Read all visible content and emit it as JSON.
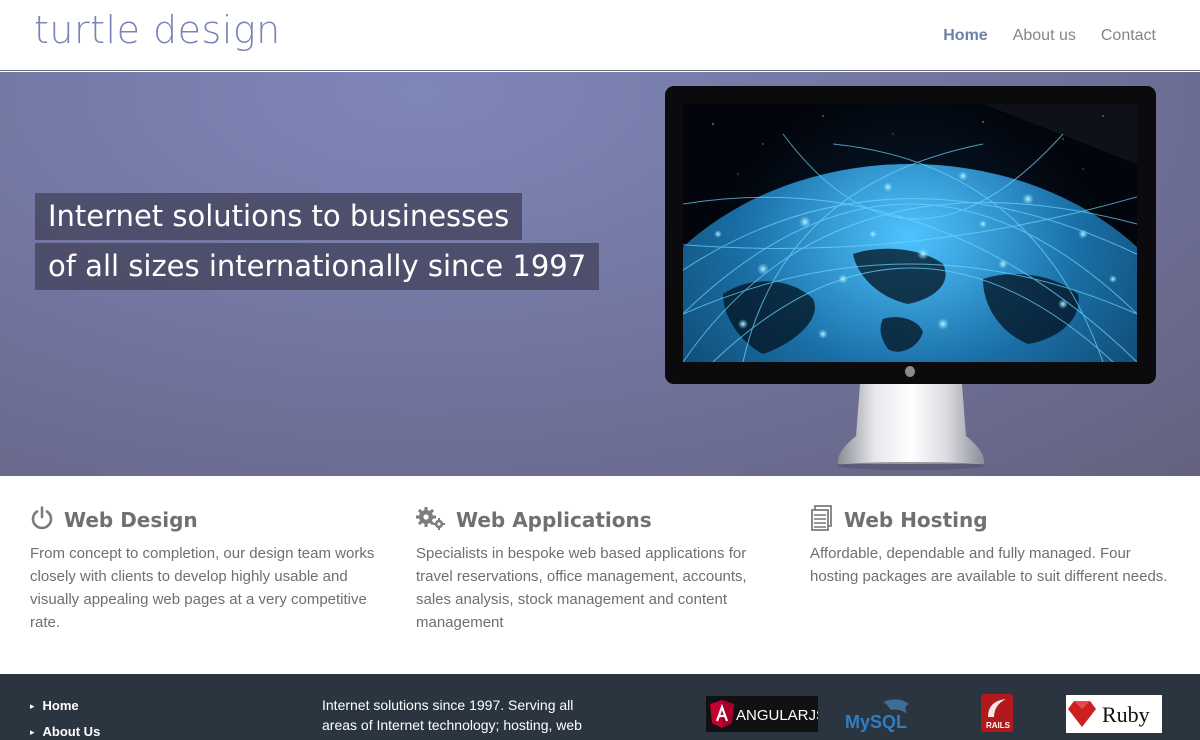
{
  "header": {
    "logo": "turtle design",
    "nav": [
      {
        "label": "Home",
        "active": true
      },
      {
        "label": "About us",
        "active": false
      },
      {
        "label": "Contact",
        "active": false
      }
    ]
  },
  "hero": {
    "headline_line1": "Internet solutions to businesses",
    "headline_line2": "of all sizes internationally since 1997"
  },
  "services": [
    {
      "icon": "power-icon",
      "title": "Web Design",
      "text": "From concept to completion, our design team works closely with clients to develop highly usable and visually appealing web pages at a very competitive rate."
    },
    {
      "icon": "gears-icon",
      "title": "Web Applications",
      "text": "Specialists in bespoke web based applications for travel reservations, office management, accounts, sales analysis, stock management and content management"
    },
    {
      "icon": "server-icon",
      "title": "Web Hosting",
      "text": "Affordable, dependable and fully managed. Four hosting packages are available to suit different needs."
    }
  ],
  "footer": {
    "links": [
      "Home",
      "About Us"
    ],
    "text": "Internet solutions since 1997. Serving all areas of Internet technology; hosting, web",
    "logos": {
      "angular": "ANGULARJS",
      "mysql": "MySQL",
      "rails": "RAILS",
      "ruby": "Ruby"
    }
  },
  "colors": {
    "accent": "#7b84b8",
    "nav_active": "#6d82a8",
    "footer_bg": "#2a3540"
  }
}
